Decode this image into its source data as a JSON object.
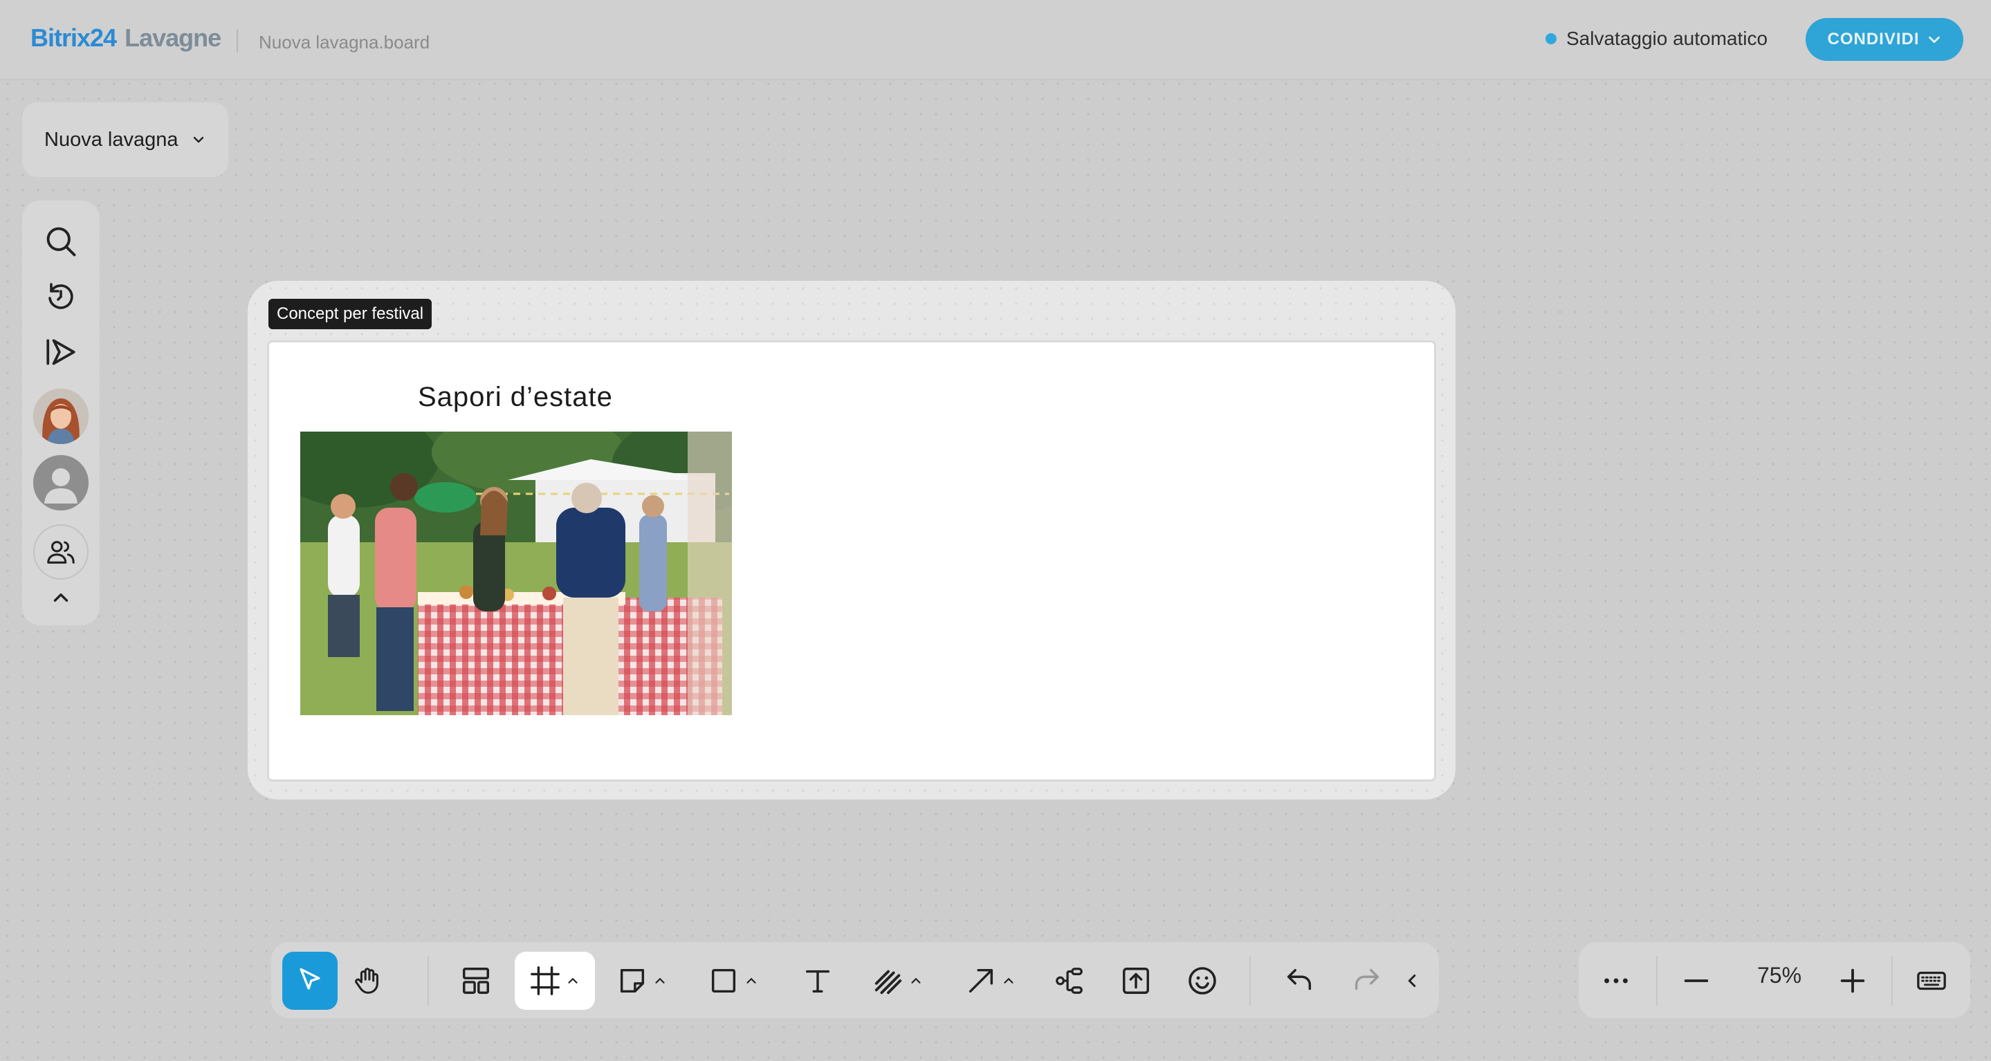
{
  "header": {
    "brand": "Bitrix24",
    "app_name": "Lavagne",
    "file_name": "Nuova lavagna.board",
    "autosave_label": "Salvataggio automatico",
    "share_label": "CONDIVIDI",
    "accent_color": "#2fa4d6"
  },
  "board_selector": {
    "label": "Nuova lavagna"
  },
  "left_panel": {
    "items": [
      "search-icon",
      "history-icon",
      "presentation-icon",
      "user-avatar-photo",
      "user-avatar-placeholder",
      "participants-icon",
      "collapse-chevron-icon"
    ]
  },
  "canvas": {
    "frame_label": "Concept per festival",
    "card_title": "Sapori d’estate",
    "image_description_icon": "festival-photo"
  },
  "toolbar": {
    "tools": [
      "select",
      "hand",
      "templates",
      "frame",
      "sticky-note",
      "shape",
      "text",
      "pen",
      "arrow",
      "mind-map",
      "upload",
      "emoji",
      "undo",
      "redo",
      "collapse"
    ],
    "active_tool": "select",
    "highlighted_tool": "frame"
  },
  "zoom": {
    "value": "75%"
  }
}
